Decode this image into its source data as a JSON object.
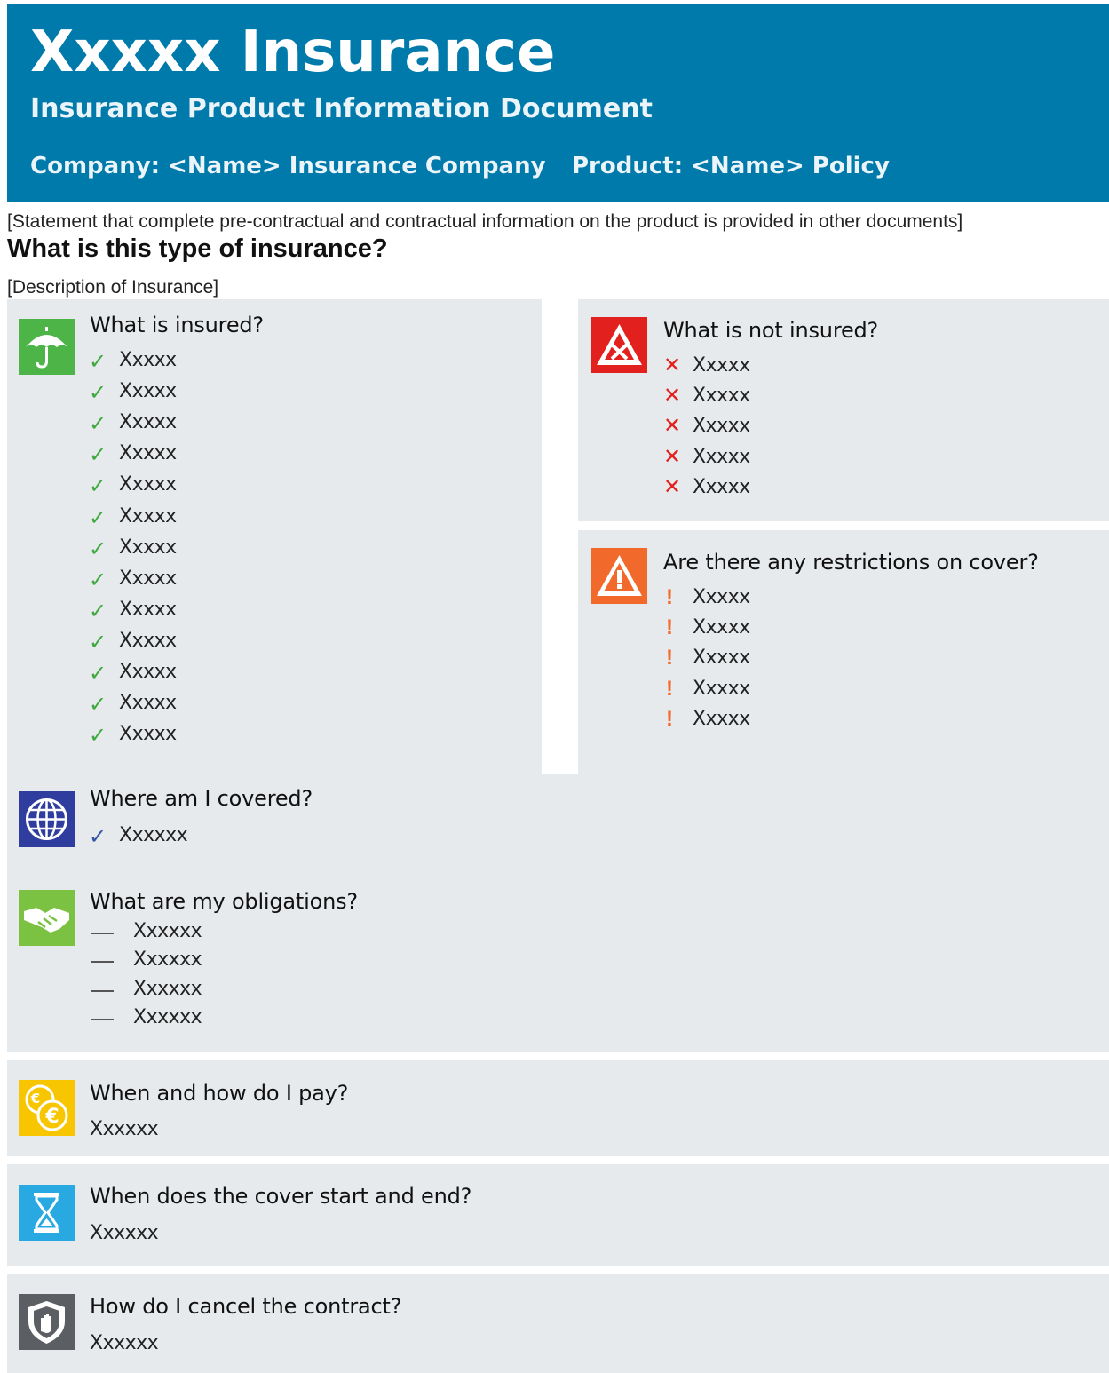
{
  "header": {
    "title": "Xxxxx Insurance",
    "subtitle": "Insurance Product Information Document",
    "company": "Company: <Name> Insurance Company",
    "product": "Product: <Name> Policy",
    "bg_color": "#0079ab"
  },
  "statement": "[Statement that complete pre-contractual and contractual information on the product is provided in other documents]",
  "type_question": "What is this type of insurance?",
  "description": "[Description of Insurance]",
  "insured": {
    "title": "What is insured?",
    "icon": "umbrella-icon",
    "icon_color": "#4db448",
    "items": [
      "Xxxxx",
      "Xxxxx",
      "Xxxxx",
      "Xxxxx",
      "Xxxxx",
      "Xxxxx",
      "Xxxxx",
      "Xxxxx",
      "Xxxxx",
      "Xxxxx",
      "Xxxxx",
      "Xxxxx",
      "Xxxxx"
    ]
  },
  "not_insured": {
    "title": "What is not insured?",
    "icon": "warning-cross-icon",
    "icon_color": "#e2201d",
    "items": [
      "Xxxxx",
      "Xxxxx",
      "Xxxxx",
      "Xxxxx",
      "Xxxxx"
    ]
  },
  "restrictions": {
    "title": "Are there any restrictions on cover?",
    "icon": "warning-exclamation-icon",
    "icon_color": "#f26a2b",
    "items": [
      "Xxxxx",
      "Xxxxx",
      "Xxxxx",
      "Xxxxx",
      "Xxxxx"
    ]
  },
  "covered": {
    "title": "Where am I covered?",
    "icon": "globe-icon",
    "icon_color": "#2f3e9e",
    "items": [
      "Xxxxxx"
    ]
  },
  "obligations": {
    "title": "What are my obligations?",
    "icon": "handshake-icon",
    "icon_color": "#7cc242",
    "items": [
      "Xxxxxx",
      "Xxxxxx",
      "Xxxxxx",
      "Xxxxxx"
    ]
  },
  "payment": {
    "title": "When and how do I pay?",
    "icon": "euro-coins-icon",
    "icon_color": "#f7c600",
    "text": "Xxxxxx"
  },
  "cover_period": {
    "title": "When does the cover start and end?",
    "icon": "hourglass-icon",
    "icon_color": "#29a9e1",
    "text": "Xxxxxx"
  },
  "cancel": {
    "title": "How do I cancel the contract?",
    "icon": "shield-hand-icon",
    "icon_color": "#5b5f63",
    "text": "Xxxxxx"
  }
}
